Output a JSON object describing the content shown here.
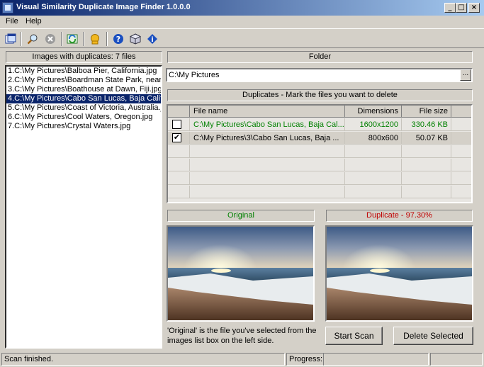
{
  "window": {
    "title": "Visual Similarity Duplicate Image Finder 1.0.0.0",
    "min_glyph": "_",
    "max_glyph": "□",
    "close_glyph": "×"
  },
  "menu": {
    "file": "File",
    "help": "Help"
  },
  "toolbar": {
    "icons": [
      "new-window-icon",
      "search-icon",
      "stop-icon",
      "refresh-icon",
      "hand-icon",
      "help-icon",
      "box-icon",
      "info-icon"
    ]
  },
  "left": {
    "header": "Images with duplicates: 7 files",
    "items": [
      "1.C:\\My Pictures\\Balboa Pier, California.jpg",
      "2.C:\\My Pictures\\Boardman State Park, near",
      "3.C:\\My Pictures\\Boathouse at Dawn, Fiji.jpg",
      "4.C:\\My Pictures\\Cabo San Lucas, Baja Calif",
      "5.C:\\My Pictures\\Coast of Victoria, Australia.jp",
      "6.C:\\My Pictures\\Cool Waters, Oregon.jpg",
      "7.C:\\My Pictures\\Crystal Waters.jpg"
    ],
    "selected_index": 3
  },
  "folder": {
    "header": "Folder",
    "value": "C:\\My Pictures",
    "browse_label": "..."
  },
  "duplicates": {
    "header": "Duplicates - Mark the files you want to delete",
    "columns": [
      "File name",
      "Dimensions",
      "File size"
    ],
    "rows": [
      {
        "checked": false,
        "checkmark": "",
        "file": "C:\\My Pictures\\Cabo San Lucas, Baja Cal...",
        "dimensions": "1600x1200",
        "size": "330.46 KB",
        "color": "#008000"
      },
      {
        "checked": true,
        "checkmark": "✔",
        "file": "C:\\My Pictures\\3\\Cabo San Lucas, Baja ...",
        "dimensions": "800x600",
        "size": "50.07 KB",
        "color": "#000000"
      }
    ]
  },
  "preview": {
    "original_label": "Original",
    "duplicate_label": "Duplicate - 97.30%",
    "original_color": "#008000",
    "duplicate_color": "#c00000",
    "note": "'Original' is the file you've selected from the images list box on the left side."
  },
  "buttons": {
    "start_scan": "Start Scan",
    "delete_selected": "Delete Selected"
  },
  "status": {
    "message": "Scan finished.",
    "progress_label": "Progress:"
  }
}
